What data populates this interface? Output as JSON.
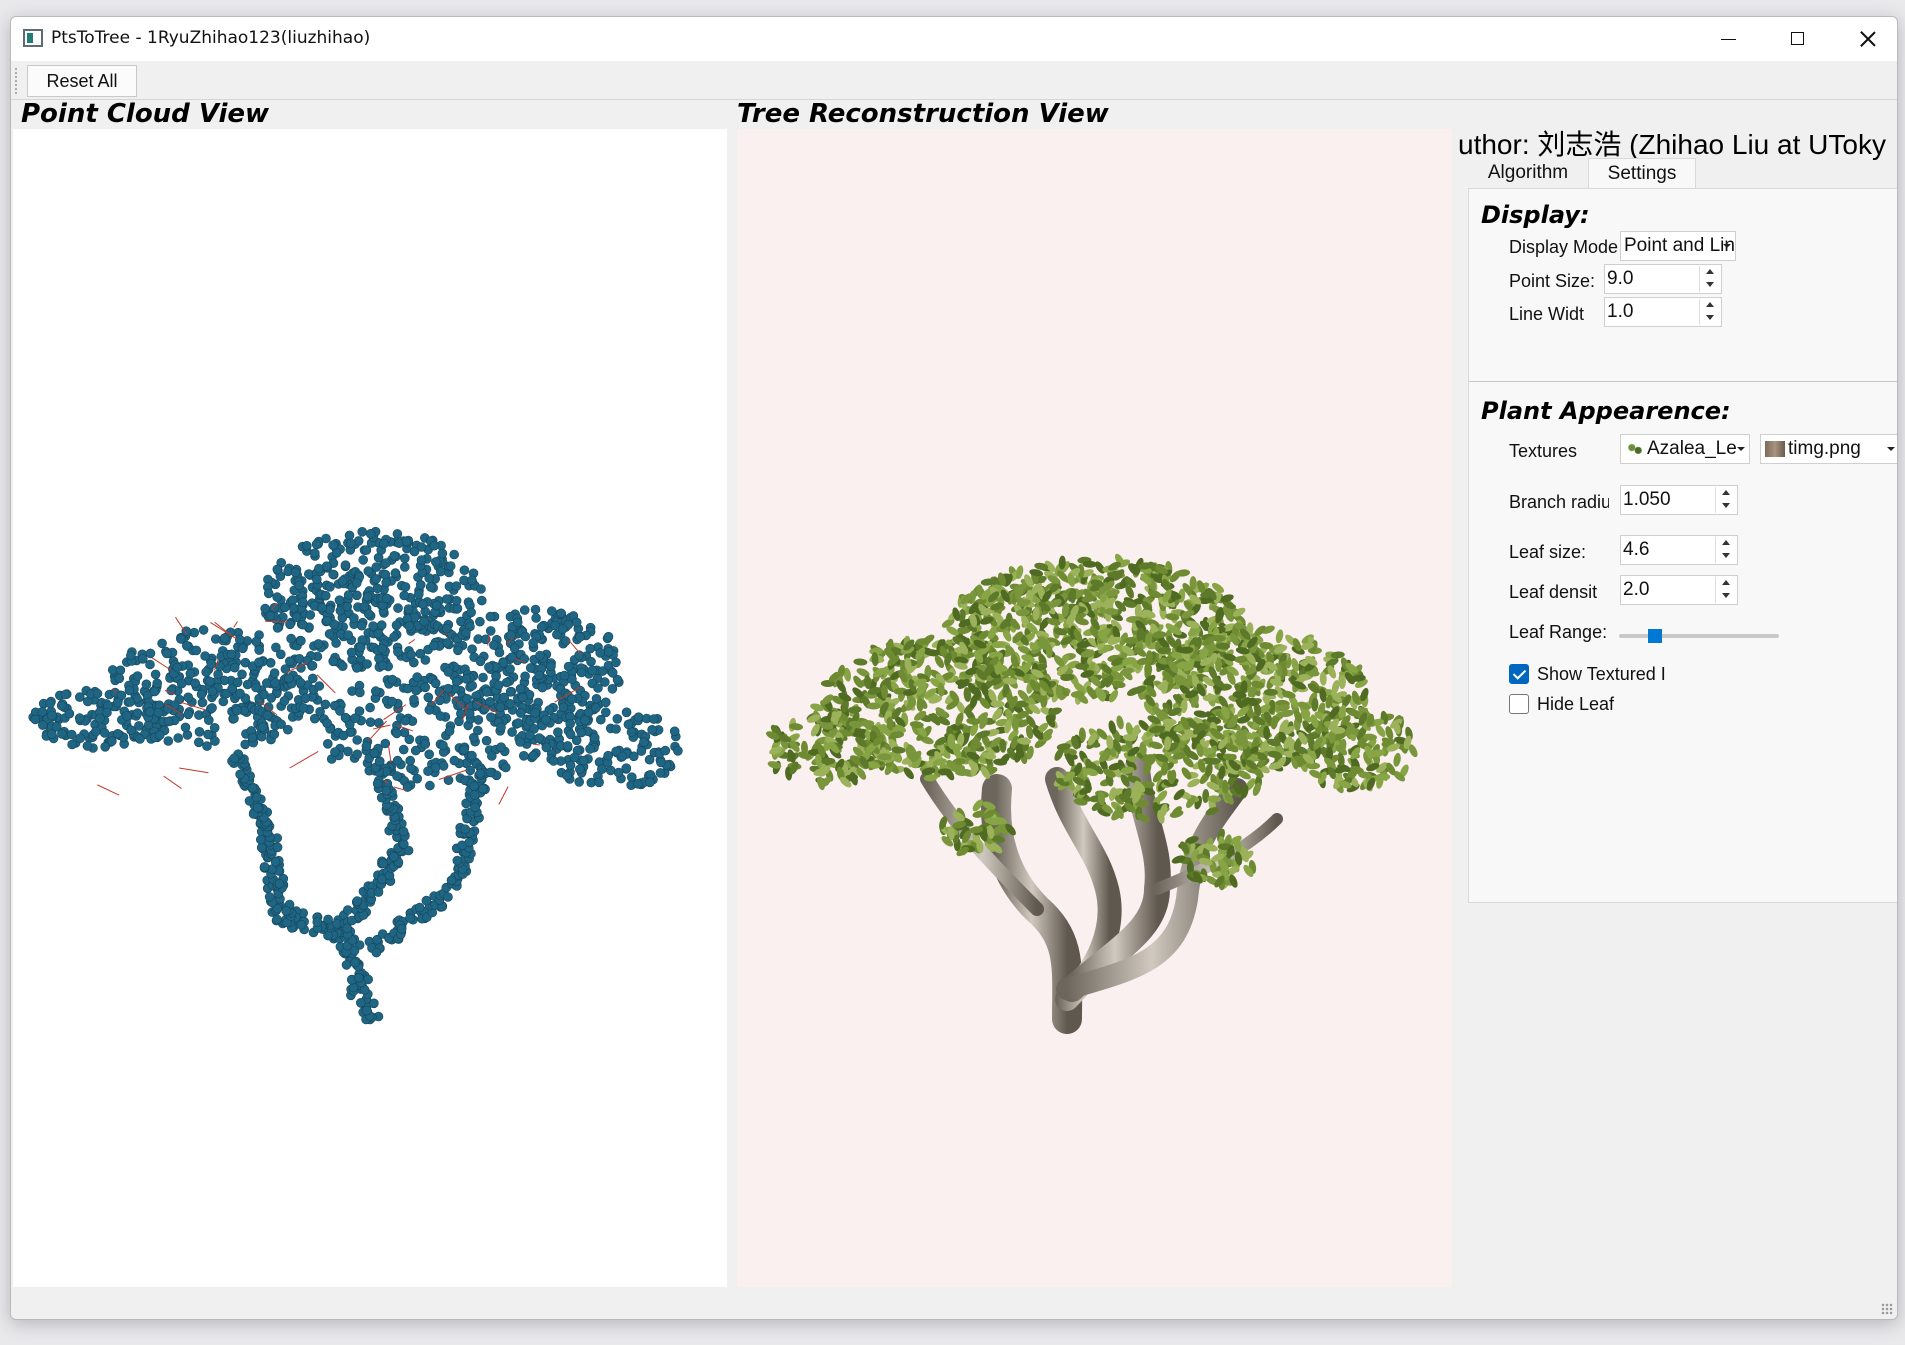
{
  "window": {
    "title": "PtsToTree - 1RyuZhihao123(liuzhihao)"
  },
  "toolbar": {
    "reset_label": "Reset All"
  },
  "views": {
    "point_cloud_title": "Point Cloud View",
    "tree_title": "Tree Reconstruction View"
  },
  "side_panel": {
    "author": "uthor: 刘志浩 (Zhihao Liu at UToky",
    "tabs": [
      {
        "label": "Algorithm",
        "active": false
      },
      {
        "label": "Settings",
        "active": true
      }
    ],
    "display": {
      "heading": "Display:",
      "display_mode_label": "Display Mode",
      "display_mode_value": "Point and Line",
      "point_size_label": "Point Size:",
      "point_size_value": "9.0",
      "line_width_label": "Line Widt",
      "line_width_value": "1.0"
    },
    "plant": {
      "heading": "Plant Appearence:",
      "textures_label": "Textures",
      "leaf_texture_value": "Azalea_Le",
      "bark_texture_value": "timg.png",
      "branch_radius_label": "Branch radiu",
      "branch_radius_value": "1.050",
      "leaf_size_label": "Leaf size:",
      "leaf_size_value": "4.6",
      "leaf_density_label": "Leaf densit",
      "leaf_density_value": "2.0",
      "leaf_range_label": "Leaf Range:",
      "leaf_range_fraction": 0.2,
      "show_textured_label": "Show Textured I",
      "show_textured_checked": true,
      "hide_leaf_label": "Hide Leaf",
      "hide_leaf_checked": false
    }
  },
  "colors": {
    "point_color": "#1f6584",
    "line_color": "#c0392b",
    "leaf_green": "#7d9a3a",
    "bark": "#8a8278",
    "accent": "#0067c0"
  }
}
